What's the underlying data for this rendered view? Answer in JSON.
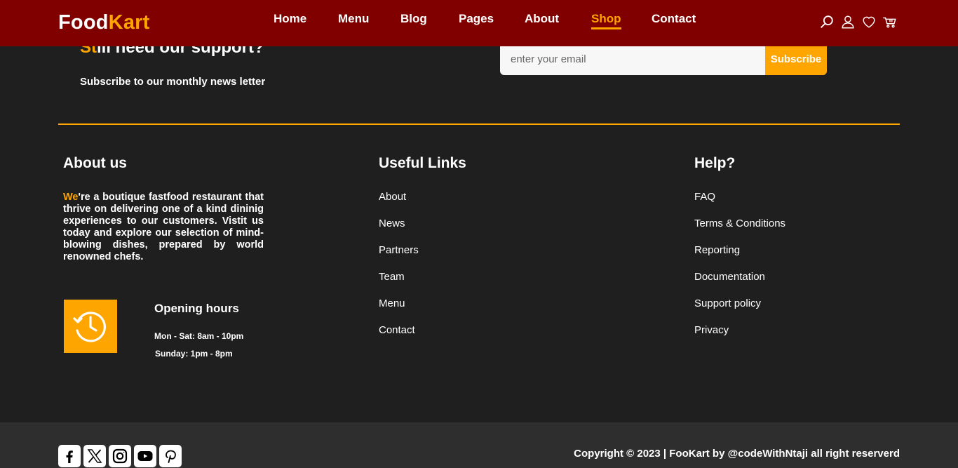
{
  "header": {
    "logo_part1": "Food",
    "logo_part2": "Kart",
    "nav": [
      {
        "label": "Home"
      },
      {
        "label": "Menu"
      },
      {
        "label": "Blog"
      },
      {
        "label": "Pages"
      },
      {
        "label": "About"
      },
      {
        "label": "Shop",
        "active": true
      },
      {
        "label": "Contact"
      }
    ],
    "icons": [
      "search-icon",
      "user-icon",
      "heart-icon",
      "cart-icon"
    ]
  },
  "newsletter": {
    "title_highlight": "St",
    "title_rest": "ill need our support?",
    "subtitle": "Subscribe to our monthly news letter",
    "email_placeholder": "enter your email",
    "subscribe_label": "Subscribe"
  },
  "about": {
    "title": "About us",
    "text_highlight": "We",
    "text_rest": "'re a boutique fastfood restaurant that thrive on delivering one of a kind dininig experiences to our customers. Vistit us today and explore our selection of mind-blowing dishes, prepared by world renowned chefs.",
    "opening_title": "Opening hours",
    "hours_weekday": "Mon - Sat: 8am - 10pm",
    "hours_sunday": "Sunday: 1pm - 8pm",
    "clock_icon": "clock-history-icon"
  },
  "useful_links": {
    "title": "Useful Links",
    "items": [
      "About",
      "News",
      "Partners",
      "Team",
      "Menu",
      "Contact"
    ]
  },
  "help": {
    "title": "Help?",
    "items": [
      "FAQ",
      "Terms & Conditions",
      "Reporting",
      "Documentation",
      "Support policy",
      "Privacy"
    ]
  },
  "footer": {
    "socials": [
      "facebook-icon",
      "x-icon",
      "instagram-icon",
      "youtube-icon",
      "pinterest-icon"
    ],
    "copyright": "Copyright © 2023 | FooKart by @codeWithNtaji all right reserverd"
  },
  "colors": {
    "header_bg": "#800000",
    "accent": "#ffa500",
    "body_bg": "#1f1f1f",
    "bottom_bg": "#2e2e2e"
  }
}
